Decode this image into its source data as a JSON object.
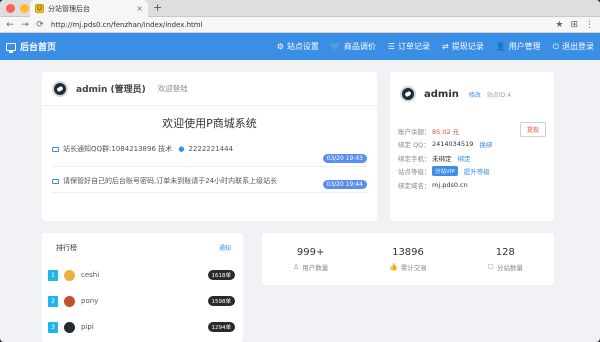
{
  "browser": {
    "tab_title": "分站管理后台",
    "url": "http://mj.pds0.cn/fenzhan/index/index.html",
    "new_tab": "+",
    "tab_close": "×",
    "favicon": "☺"
  },
  "header": {
    "brand": "后台首页",
    "menu": [
      {
        "icon": "⚙",
        "label": "站点设置"
      },
      {
        "icon": "🛒",
        "label": "商品调价"
      },
      {
        "icon": "☰",
        "label": "订单记录"
      },
      {
        "icon": "⇄",
        "label": "提现记录"
      },
      {
        "icon": "👤",
        "label": "用户管理"
      },
      {
        "icon": "⏻",
        "label": "退出登录"
      }
    ]
  },
  "welcome": {
    "username": "admin (管理员)",
    "greeting": "欢迎登陆",
    "title": "欢迎使用P商城系统",
    "notices": [
      {
        "text": "站长通知QQ群:1084213896 技术 ",
        "icon_text": "2222221444",
        "date": "03/20 19:43"
      },
      {
        "text": "请保管好自己的后台账号密码,订单未到账请于24小时内联系上级站长",
        "icon_text": "",
        "date": "03/20 19:44"
      }
    ]
  },
  "profile": {
    "name": "admin",
    "modify": "修改",
    "site_id": "站点ID:4",
    "withdraw_button": "提现",
    "rows": [
      {
        "label": "账户余额：",
        "value": "85.02 元",
        "extra": "",
        "style": "red"
      },
      {
        "label": "绑定 QQ：",
        "value": "2414034519",
        "extra": "换绑",
        "style": ""
      },
      {
        "label": "绑定手机：",
        "value": "未绑定",
        "extra": "绑定",
        "style": ""
      },
      {
        "label": "站点等级：",
        "value": "分站VIP",
        "extra": "提升等级",
        "style": "pill"
      },
      {
        "label": "绑定域名：",
        "value": "mj.pds0.cn",
        "extra": "",
        "style": ""
      }
    ]
  },
  "rank": {
    "title": "排行榜",
    "link": "通知",
    "items": [
      {
        "num": "1",
        "name": "ceshi",
        "count": "1618单",
        "avatar_color": "#e8b13b"
      },
      {
        "num": "2",
        "name": "pony",
        "count": "1598单",
        "avatar_color": "#c1502e"
      },
      {
        "num": "3",
        "name": "pipi",
        "count": "1294单",
        "avatar_color": "#1f2a33"
      }
    ]
  },
  "stats": [
    {
      "value": "999+",
      "label": "用户数量",
      "icon": "♙"
    },
    {
      "value": "13896",
      "label": "累计交易",
      "icon": "👍"
    },
    {
      "value": "128",
      "label": "分站数量",
      "icon": "☐"
    }
  ],
  "colors": {
    "primary": "#3a8ee6",
    "danger": "#e64a3b",
    "badge": "#5b8def",
    "rank_number": "#1fb5e8"
  }
}
